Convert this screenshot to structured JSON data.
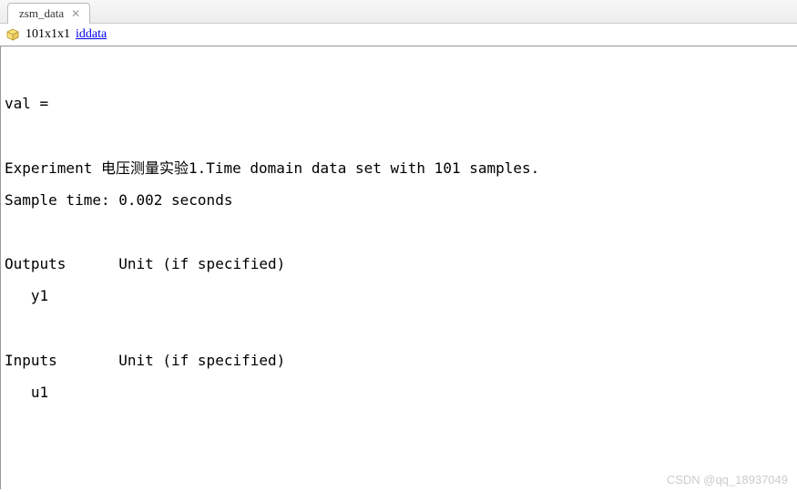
{
  "tab": {
    "label": "zsm_data"
  },
  "info": {
    "dimensions": "101x1x1",
    "type_link": "iddata"
  },
  "content": {
    "val_header": "val =",
    "experiment_line": "Experiment 电压测量实验1.Time domain data set with 101 samples.",
    "sample_time_line": "Sample time: 0.002 seconds",
    "outputs_header": "Outputs      Unit (if specified)",
    "output1": "   y1",
    "inputs_header": "Inputs       Unit (if specified)",
    "input1": "   u1"
  },
  "watermark": "CSDN @qq_18937049"
}
